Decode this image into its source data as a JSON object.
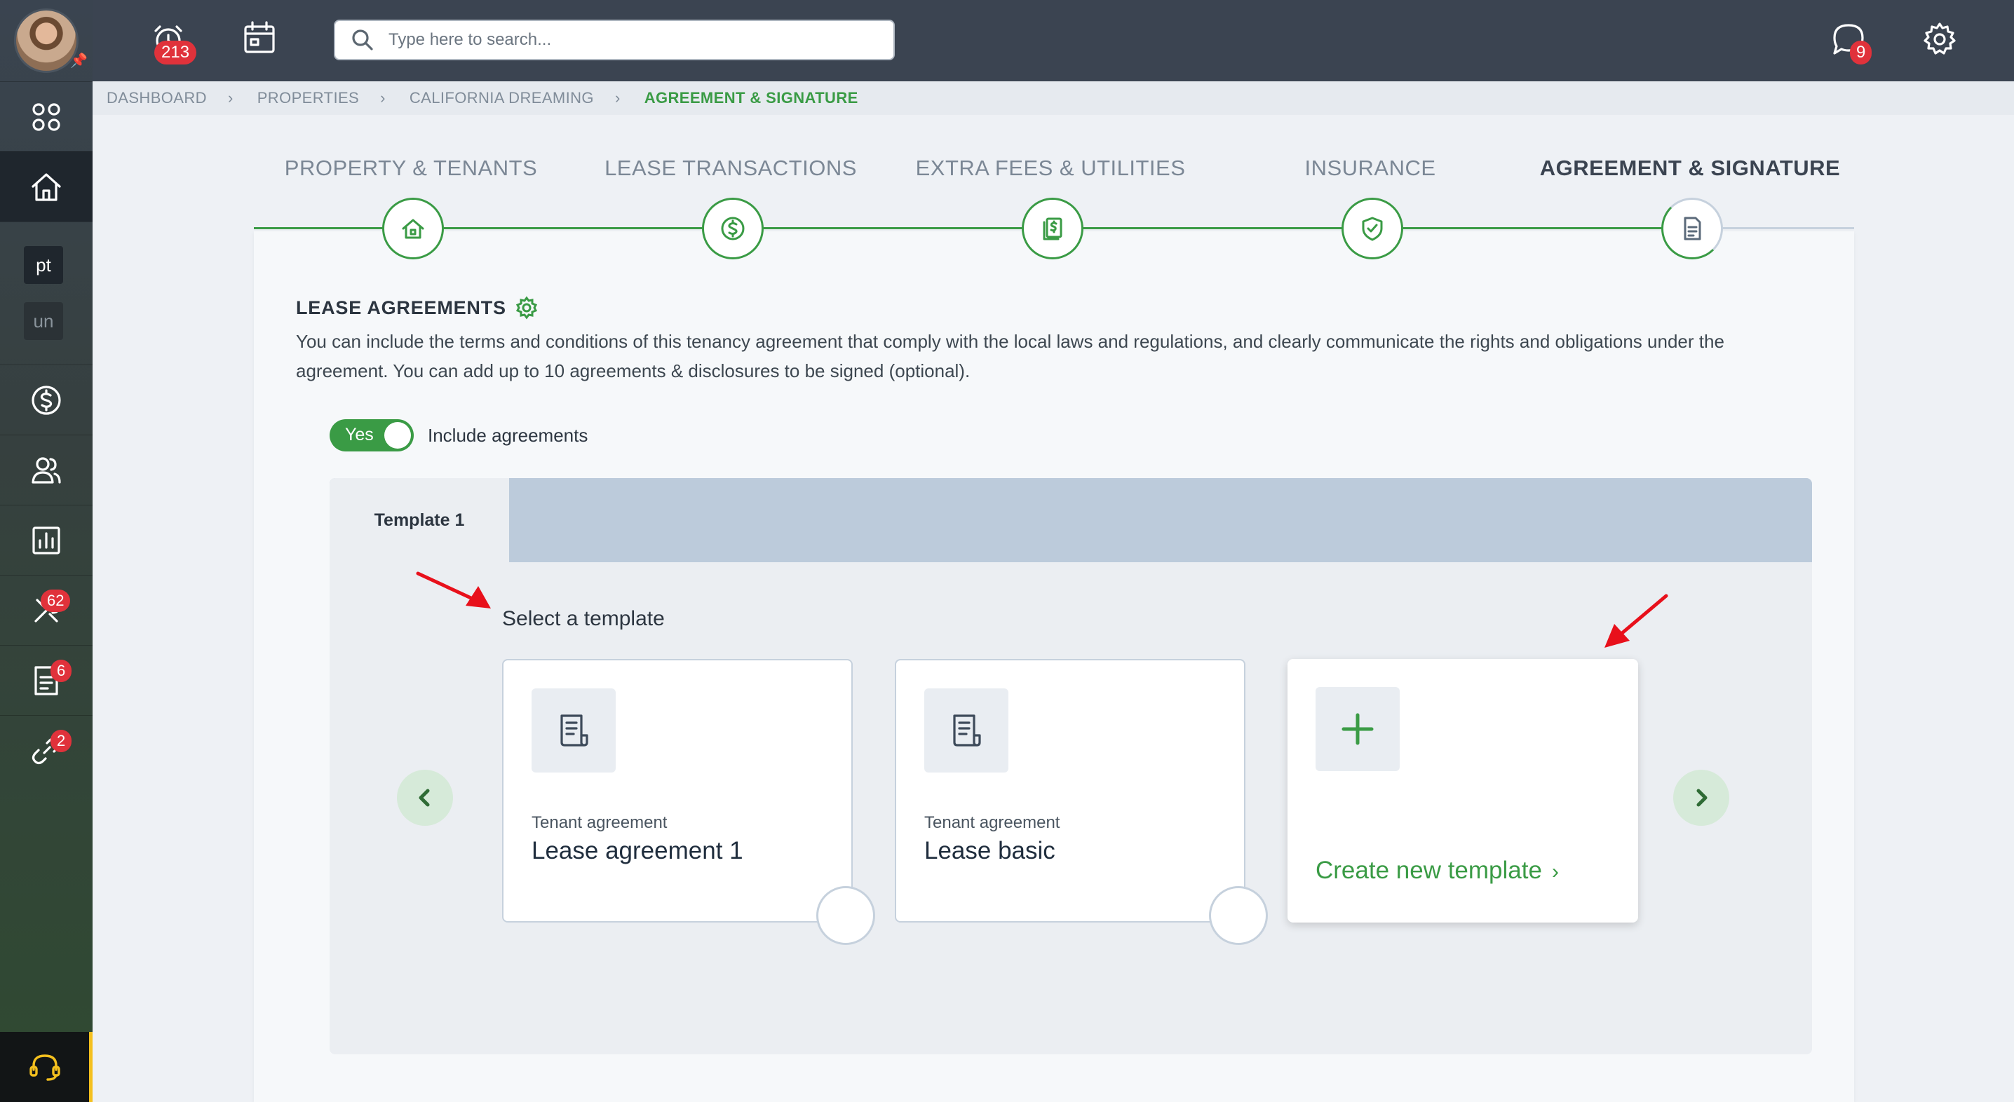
{
  "topbar": {
    "notifications_count": "213",
    "search_placeholder": "Type here to search...",
    "messages_count": "9"
  },
  "sidebar": {
    "tags": [
      "pt",
      "un"
    ],
    "badges": {
      "maintenance": "62",
      "documents": "6",
      "links": "2"
    }
  },
  "breadcrumb": {
    "items": [
      "DASHBOARD",
      "PROPERTIES",
      "CALIFORNIA DREAMING",
      "AGREEMENT & SIGNATURE"
    ]
  },
  "steps": [
    {
      "label": "PROPERTY & TENANTS",
      "icon": "home-icon"
    },
    {
      "label": "LEASE TRANSACTIONS",
      "icon": "dollar-icon"
    },
    {
      "label": "EXTRA FEES & UTILITIES",
      "icon": "fees-icon"
    },
    {
      "label": "INSURANCE",
      "icon": "shield-icon"
    },
    {
      "label": "AGREEMENT & SIGNATURE",
      "icon": "document-icon"
    }
  ],
  "lease": {
    "title": "LEASE AGREEMENTS",
    "description": "You can include the terms and conditions of this tenancy agreement that comply with the local laws and regulations, and clearly communicate the rights and obligations under the agreement. You can add up to 10 agreements & disclosures to be signed (optional).",
    "toggle_value": "Yes",
    "toggle_label": "Include agreements"
  },
  "templates": {
    "tab": "Template 1",
    "select_label": "Select a template",
    "cards": [
      {
        "kind": "Tenant agreement",
        "name": "Lease agreement 1"
      },
      {
        "kind": "Tenant agreement",
        "name": "Lease basic"
      }
    ],
    "create_label": "Create new template",
    "create_chevron": "›"
  },
  "colors": {
    "accent": "#3a9b45",
    "topbar": "#3b4451",
    "badge": "#e0323b",
    "annotation_arrow": "#e8101b"
  }
}
